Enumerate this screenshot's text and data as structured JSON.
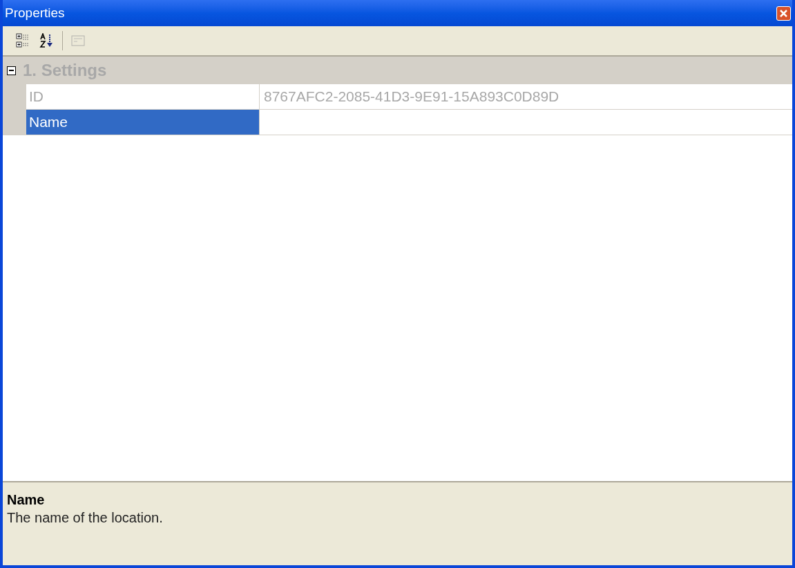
{
  "window": {
    "title": "Properties"
  },
  "toolbar": {
    "buttons": [
      {
        "kind": "categorized",
        "selected": false
      },
      {
        "kind": "alphabetical",
        "selected": false
      },
      {
        "kind": "pages",
        "disabled": true
      }
    ]
  },
  "grid": {
    "categories": [
      {
        "label": "1. Settings",
        "expanded": true,
        "properties": [
          {
            "name": "ID",
            "value": "8767AFC2-2085-41D3-9E91-15A893C0D89D",
            "readonly": true,
            "selected": false
          },
          {
            "name": "Name",
            "readonly": false,
            "selected": true
          }
        ]
      }
    ]
  },
  "description": {
    "title": "Name",
    "text": "The name of the location."
  }
}
